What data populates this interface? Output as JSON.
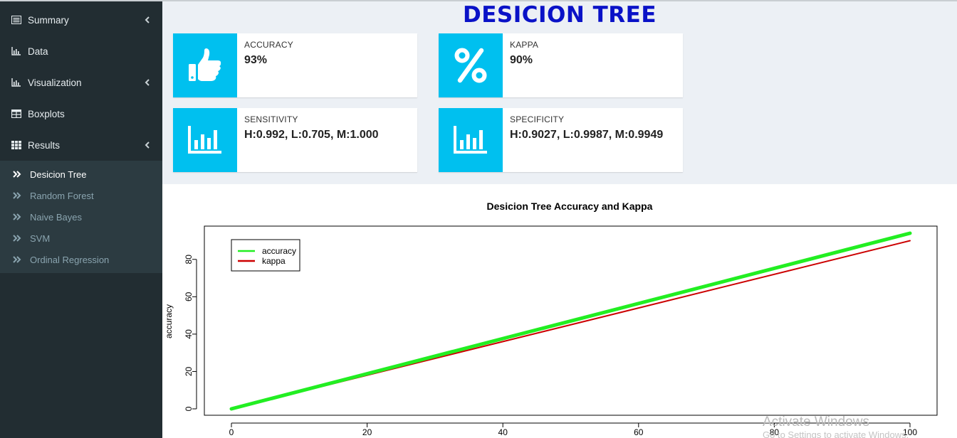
{
  "sidebar": {
    "items": [
      {
        "label": "Summary",
        "icon": "list-icon",
        "has_chevron": true
      },
      {
        "label": "Data",
        "icon": "bar-chart-icon",
        "has_chevron": false
      },
      {
        "label": "Visualization",
        "icon": "bar-chart-icon",
        "has_chevron": true
      },
      {
        "label": "Boxplots",
        "icon": "table-icon",
        "has_chevron": false
      },
      {
        "label": "Results",
        "icon": "grid-icon",
        "has_chevron": true
      }
    ],
    "results_submenu": [
      {
        "label": "Desicion Tree",
        "active": true
      },
      {
        "label": "Random Forest",
        "active": false
      },
      {
        "label": "Naive Bayes",
        "active": false
      },
      {
        "label": "SVM",
        "active": false
      },
      {
        "label": "Ordinal Regression",
        "active": false
      }
    ]
  },
  "page": {
    "title": "DESICION TREE"
  },
  "cards": {
    "accuracy": {
      "caption": "ACCURACY",
      "value": "93%",
      "icon": "thumbs-up-icon"
    },
    "kappa": {
      "caption": "KAPPA",
      "value": "90%",
      "icon": "percent-icon"
    },
    "sensitivity": {
      "caption": "SENSITIVITY",
      "value": "H:0.992, L:0.705, M:1.000",
      "icon": "bar-chart-icon"
    },
    "specificity": {
      "caption": "SPECIFICITY",
      "value": "H:0.9027, L:0.9987, M:0.9949",
      "icon": "bar-chart-icon"
    }
  },
  "chart_data": {
    "type": "line",
    "title": "Desicion Tree Accuracy and Kappa",
    "xlabel": "",
    "ylabel": "accuracy",
    "xlim": [
      0,
      100
    ],
    "ylim": [
      0,
      94
    ],
    "xticks": [
      0,
      20,
      40,
      60,
      80,
      100
    ],
    "yticks": [
      0,
      20,
      40,
      60,
      80
    ],
    "grid": false,
    "legend_position": "top-left",
    "series": [
      {
        "name": "accuracy",
        "color": "#22ee22",
        "x": [
          0,
          100
        ],
        "y": [
          0,
          94
        ]
      },
      {
        "name": "kappa",
        "color": "#cc0000",
        "x": [
          0,
          100
        ],
        "y": [
          0,
          90
        ]
      }
    ]
  },
  "watermark": {
    "line1": "Activate Windows",
    "line2": "Go to Settings to activate Windows."
  },
  "colors": {
    "sidebar_bg": "#222d32",
    "info_box": "#00c0ef",
    "title": "#0a12c7"
  }
}
